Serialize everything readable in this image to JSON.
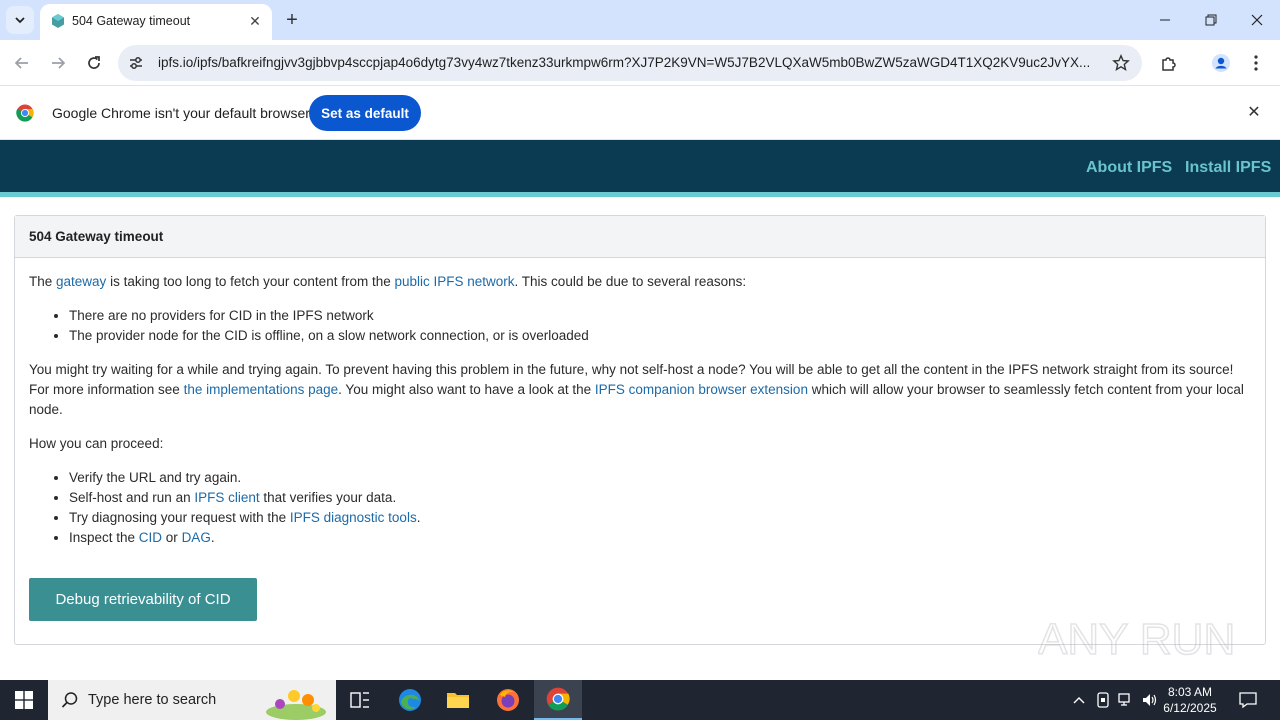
{
  "browser": {
    "tab": {
      "title": "504 Gateway timeout"
    },
    "url": "ipfs.io/ipfs/bafkreifngjvv3gjbbvp4sccpjap4o6dytg73vy4wz7tkenz33urkmpw6rm?XJ7P2K9VN=W5J7B2VLQXaW5mb0BwZW5zaWGD4T1XQ2KV9uc2JvYX...",
    "infobar": {
      "message": "Google Chrome isn't your default browser",
      "button": "Set as default"
    }
  },
  "header": {
    "nav": [
      "About IPFS",
      "Install IPFS"
    ]
  },
  "card": {
    "title": "504 Gateway timeout",
    "intro": {
      "t1": "The ",
      "link1": "gateway",
      "t2": " is taking too long to fetch your content from the ",
      "link2": "public IPFS network",
      "t3": ". This could be due to several reasons:"
    },
    "reasons": [
      "There are no providers for CID in the IPFS network",
      "The provider node for the CID is offline, on a slow network connection, or is overloaded"
    ],
    "advice": {
      "t1": "You might try waiting for a while and trying again. To prevent having this problem in the future, why not self-host a node? You will be able to get all the content in the IPFS network straight from its source! For more information see ",
      "link1": "the implementations page",
      "t2": ". You might also want to have a look at the ",
      "link2": "IPFS companion browser extension",
      "t3": " which will allow your browser to seamlessly fetch content from your local node."
    },
    "proceed_heading": "How you can proceed:",
    "steps": {
      "s1": "Verify the URL and try again.",
      "s2_a": "Self-host and run an ",
      "s2_link": "IPFS client",
      "s2_b": " that verifies your data.",
      "s3_a": "Try diagnosing your request with the ",
      "s3_link": "IPFS diagnostic tools",
      "s3_b": ".",
      "s4_a": "Inspect the ",
      "s4_link1": "CID",
      "s4_mid": " or ",
      "s4_link2": "DAG",
      "s4_b": "."
    },
    "button": "Debug retrievability of CID"
  },
  "watermark": "ANY RUN",
  "taskbar": {
    "search_placeholder": "Type here to search",
    "time": "8:03 AM",
    "date": "6/12/2025"
  },
  "colors": {
    "header_bg": "#0b3a53",
    "header_accent": "#6acad1",
    "link": "#1c6aa8",
    "button": "#3a8f93",
    "chrome_blue": "#0b57d0"
  }
}
